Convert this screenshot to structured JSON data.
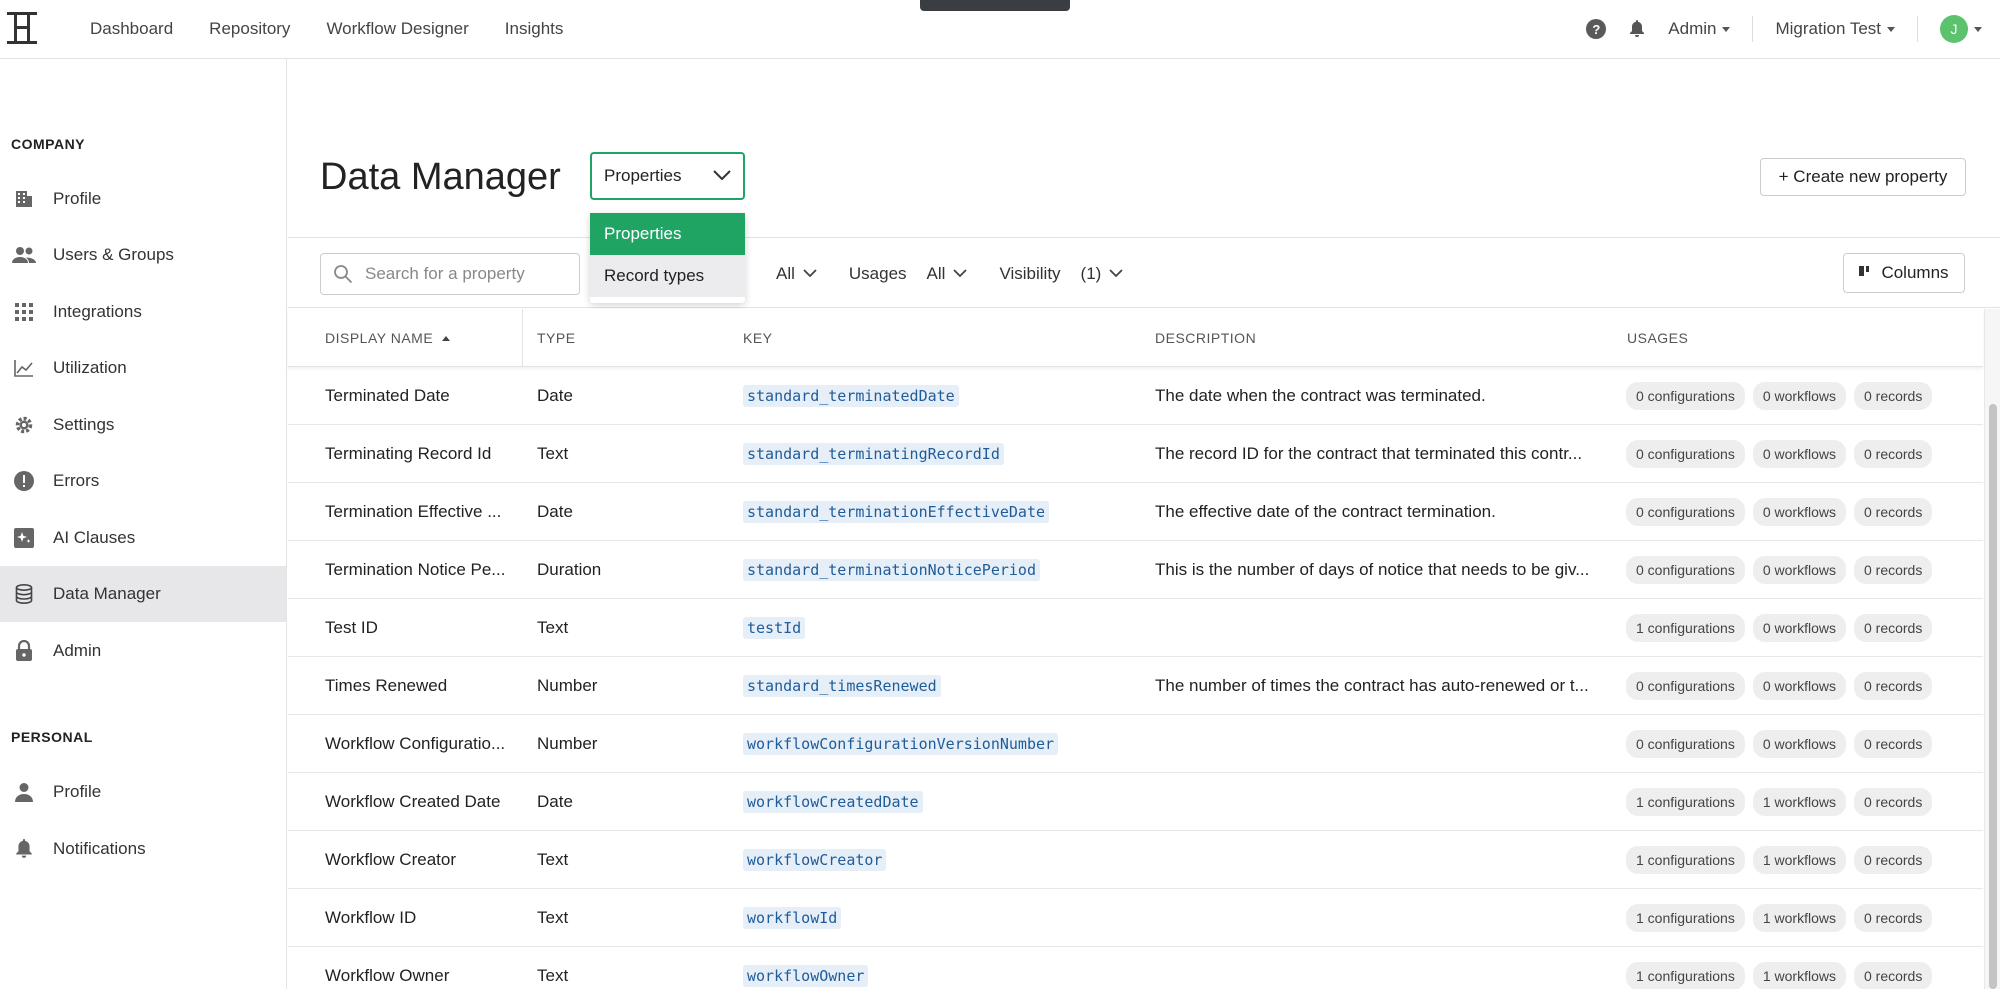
{
  "nav": {
    "items": [
      "Dashboard",
      "Repository",
      "Workflow Designer",
      "Insights"
    ],
    "admin_label": "Admin",
    "workspace_label": "Migration Test",
    "avatar_initial": "J"
  },
  "sidebar": {
    "company_label": "COMPANY",
    "company_items": [
      {
        "label": "Profile",
        "icon": "building-icon"
      },
      {
        "label": "Users & Groups",
        "icon": "people-icon"
      },
      {
        "label": "Integrations",
        "icon": "grid-icon"
      },
      {
        "label": "Utilization",
        "icon": "chart-line-icon"
      },
      {
        "label": "Settings",
        "icon": "gear-icon"
      },
      {
        "label": "Errors",
        "icon": "alert-circle-icon"
      },
      {
        "label": "AI Clauses",
        "icon": "ai-sparkle-icon"
      },
      {
        "label": "Data Manager",
        "icon": "database-icon",
        "active": true
      },
      {
        "label": "Admin",
        "icon": "lock-icon"
      }
    ],
    "personal_label": "PERSONAL",
    "personal_items": [
      {
        "label": "Profile",
        "icon": "person-icon"
      },
      {
        "label": "Notifications",
        "icon": "bell-icon"
      }
    ]
  },
  "main": {
    "title": "Data Manager",
    "select_value": "Properties",
    "dropdown_options": [
      "Properties",
      "Record types"
    ],
    "create_button": "+ Create new property",
    "search_placeholder": "Search for a property",
    "filters": {
      "type_value": "All",
      "usages_label": "Usages",
      "usages_value": "All",
      "visibility_label": "Visibility",
      "visibility_value": "(1)"
    },
    "columns_button": "Columns"
  },
  "table": {
    "headers": {
      "display_name": "DISPLAY NAME",
      "type": "TYPE",
      "key": "KEY",
      "description": "DESCRIPTION",
      "usages": "USAGES"
    },
    "rows": [
      {
        "name": "Terminated Date",
        "type": "Date",
        "key": "standard_terminatedDate",
        "description": "The date when the contract was terminated.",
        "configurations": "0 configurations",
        "workflows": "0 workflows",
        "records": "0 records"
      },
      {
        "name": "Terminating Record Id",
        "type": "Text",
        "key": "standard_terminatingRecordId",
        "description": "The record ID for the contract that terminated this contr...",
        "configurations": "0 configurations",
        "workflows": "0 workflows",
        "records": "0 records"
      },
      {
        "name": "Termination Effective ...",
        "type": "Date",
        "key": "standard_terminationEffectiveDate",
        "description": "The effective date of the contract termination.",
        "configurations": "0 configurations",
        "workflows": "0 workflows",
        "records": "0 records"
      },
      {
        "name": "Termination Notice Pe...",
        "type": "Duration",
        "key": "standard_terminationNoticePeriod",
        "description": "This is the number of days of notice that needs to be giv...",
        "configurations": "0 configurations",
        "workflows": "0 workflows",
        "records": "0 records"
      },
      {
        "name": "Test ID",
        "type": "Text",
        "key": "testId",
        "description": "",
        "configurations": "1 configurations",
        "workflows": "0 workflows",
        "records": "0 records"
      },
      {
        "name": "Times Renewed",
        "type": "Number",
        "key": "standard_timesRenewed",
        "description": "The number of times the contract has auto-renewed or t...",
        "configurations": "0 configurations",
        "workflows": "0 workflows",
        "records": "0 records"
      },
      {
        "name": "Workflow Configuratio...",
        "type": "Number",
        "key": "workflowConfigurationVersionNumber",
        "description": "",
        "configurations": "0 configurations",
        "workflows": "0 workflows",
        "records": "0 records"
      },
      {
        "name": "Workflow Created Date",
        "type": "Date",
        "key": "workflowCreatedDate",
        "description": "",
        "configurations": "1 configurations",
        "workflows": "1 workflows",
        "records": "0 records"
      },
      {
        "name": "Workflow Creator",
        "type": "Text",
        "key": "workflowCreator",
        "description": "",
        "configurations": "1 configurations",
        "workflows": "1 workflows",
        "records": "0 records"
      },
      {
        "name": "Workflow ID",
        "type": "Text",
        "key": "workflowId",
        "description": "",
        "configurations": "1 configurations",
        "workflows": "1 workflows",
        "records": "0 records"
      },
      {
        "name": "Workflow Owner",
        "type": "Text",
        "key": "workflowOwner",
        "description": "",
        "configurations": "1 configurations",
        "workflows": "1 workflows",
        "records": "0 records"
      }
    ]
  }
}
